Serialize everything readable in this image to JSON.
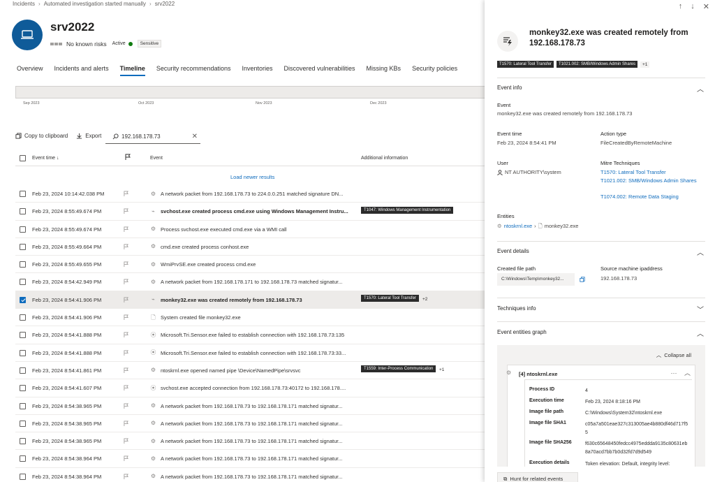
{
  "breadcrumb": [
    "Incidents",
    "Automated investigation started manually",
    "srv2022"
  ],
  "device": {
    "name": "srv2022",
    "risk": "No known risks",
    "status": "Active",
    "tag": "Sensitive"
  },
  "tabs": [
    "Overview",
    "Incidents and alerts",
    "Timeline",
    "Security recommendations",
    "Inventories",
    "Discovered vulnerabilities",
    "Missing KBs",
    "Security policies"
  ],
  "active_tab": "Timeline",
  "timeline_months": [
    "Sep 2023",
    "Oct 2023",
    "Nov 2023",
    "Dec 2023"
  ],
  "toolbar": {
    "copy": "Copy to clipboard",
    "export": "Export",
    "search_value": "192.168.178.73"
  },
  "table": {
    "col_time": "Event time ↓",
    "col_event": "Event",
    "col_info": "Additional information",
    "load_newer": "Load newer results"
  },
  "rows": [
    {
      "time": "Feb 23, 2024 10:14:42.038 PM",
      "icon": "network-icon",
      "event": "A network packet from 192.168.178.73 to 224.0.0.251 matched signature DN...",
      "tag": "",
      "more": ""
    },
    {
      "time": "Feb 23, 2024 8:55:49.674 PM",
      "icon": "process-icon",
      "event": "svchost.exe created process cmd.exe using Windows Management Instru...",
      "tag": "T1047: Windows Management Instrumentation",
      "more": "",
      "bold": true
    },
    {
      "time": "Feb 23, 2024 8:55:49.674 PM",
      "icon": "gear-icon",
      "event": "Process svchost.exe executed cmd.exe via a WMI call",
      "tag": "",
      "more": ""
    },
    {
      "time": "Feb 23, 2024 8:55:49.664 PM",
      "icon": "gear-icon",
      "event": "cmd.exe created process conhost.exe",
      "tag": "",
      "more": ""
    },
    {
      "time": "Feb 23, 2024 8:55:49.655 PM",
      "icon": "gear-icon",
      "event": "WmiPrvSE.exe created process cmd.exe",
      "tag": "",
      "more": ""
    },
    {
      "time": "Feb 23, 2024 8:54:42.949 PM",
      "icon": "network-icon",
      "event": "A network packet from 192.168.178.171 to 192.168.178.73 matched signatur...",
      "tag": "",
      "more": ""
    },
    {
      "time": "Feb 23, 2024 8:54:41.906 PM",
      "icon": "process-icon",
      "event": "monkey32.exe was created remotely from 192.168.178.73",
      "tag": "T1570: Lateral Tool Transfer",
      "more": "+2",
      "selected": true
    },
    {
      "time": "Feb 23, 2024 8:54:41.906 PM",
      "icon": "file-icon",
      "event": "System created file monkey32.exe",
      "tag": "",
      "more": ""
    },
    {
      "time": "Feb 23, 2024 8:54:41.888 PM",
      "icon": "connection-icon",
      "event": "Microsoft.Tri.Sensor.exe failed to establish connection with 192.168.178.73:135",
      "tag": "",
      "more": ""
    },
    {
      "time": "Feb 23, 2024 8:54:41.888 PM",
      "icon": "connection-icon",
      "event": "Microsoft.Tri.Sensor.exe failed to establish connection with 192.168.178.73:33...",
      "tag": "",
      "more": ""
    },
    {
      "time": "Feb 23, 2024 8:54:41.861 PM",
      "icon": "gear-icon",
      "event": "ntoskrnl.exe opened named pipe \\Device\\NamedPipe\\srvsvc",
      "tag": "T1559: Inter-Process Communication",
      "more": "+1"
    },
    {
      "time": "Feb 23, 2024 8:54:41.607 PM",
      "icon": "connection-icon",
      "event": "svchost.exe accepted connection from 192.168.178.73:40172 to 192.168.178....",
      "tag": "",
      "more": ""
    },
    {
      "time": "Feb 23, 2024 8:54:38.965 PM",
      "icon": "network-icon",
      "event": "A network packet from 192.168.178.73 to 192.168.178.171 matched signatur...",
      "tag": "",
      "more": ""
    },
    {
      "time": "Feb 23, 2024 8:54:38.965 PM",
      "icon": "network-icon",
      "event": "A network packet from 192.168.178.73 to 192.168.178.171 matched signatur...",
      "tag": "",
      "more": ""
    },
    {
      "time": "Feb 23, 2024 8:54:38.965 PM",
      "icon": "network-icon",
      "event": "A network packet from 192.168.178.73 to 192.168.178.171 matched signatur...",
      "tag": "",
      "more": ""
    },
    {
      "time": "Feb 23, 2024 8:54:38.964 PM",
      "icon": "network-icon",
      "event": "A network packet from 192.168.178.73 to 192.168.178.171 matched signatur...",
      "tag": "",
      "more": ""
    },
    {
      "time": "Feb 23, 2024 8:54:38.964 PM",
      "icon": "network-icon",
      "event": "A network packet from 192.168.178.73 to 192.168.178.171 matched signatur...",
      "tag": "",
      "more": ""
    }
  ],
  "panel": {
    "title": "monkey32.exe was created remotely from 192.168.178.73",
    "tags": [
      "T1570: Lateral Tool Transfer",
      "T1021.002: SMB/Windows Admin Shares"
    ],
    "tags_more": "+1",
    "event_info": {
      "section": "Event info",
      "event_label": "Event",
      "event_value": "monkey32.exe was created remotely from 192.168.178.73",
      "time_label": "Event time",
      "time_value": "Feb 23, 2024 8:54:41 PM",
      "action_label": "Action type",
      "action_value": "FileCreatedByRemoteMachine",
      "user_label": "User",
      "user_value": "NT AUTHORITY\\system",
      "mitre_label": "Mitre Techniques",
      "mitre": [
        "T1570: Lateral Tool Transfer",
        "T1021.002: SMB/Windows Admin Shares",
        "T1074.002: Remote Data Staging"
      ],
      "entities_label": "Entities",
      "entity_parent": "ntoskrnl.exe",
      "entity_child": "monkey32.exe"
    },
    "event_details": {
      "section": "Event details",
      "path_label": "Created file path",
      "path_value": "C:\\Windows\\Temp\\monkey32...",
      "source_label": "Source machine ipaddress",
      "source_value": "192.168.178.73"
    },
    "techniques_section": "Techniques info",
    "graph_section": "Event entities graph",
    "collapse_all": "Collapse all",
    "node": {
      "title": "[4] ntoskrnl.exe",
      "props": [
        {
          "k": "Process ID",
          "v": "4"
        },
        {
          "k": "Execution time",
          "v": "Feb 23, 2024 8:18:16 PM"
        },
        {
          "k": "Image file path",
          "v": "C:\\Windows\\System32\\ntoskrnl.exe"
        },
        {
          "k": "Image file SHA1",
          "v": "c05a7a501eae327c313005ae4b880df46d717f55"
        },
        {
          "k": "Image file SHA256",
          "v": "f630c65648450fedcc4975eddda9135c80631eb8a70acd7bb7b0d32fd7d9d549"
        },
        {
          "k": "Execution details",
          "v": "Token elevation: Default, integrity level:"
        }
      ]
    },
    "hunt_button": "Hunt for related events"
  },
  "colors": {
    "accent": "#0f6cbd",
    "avatar": "#0f5b99",
    "tag_bg": "#2b2b2b",
    "status": "#107c10"
  }
}
